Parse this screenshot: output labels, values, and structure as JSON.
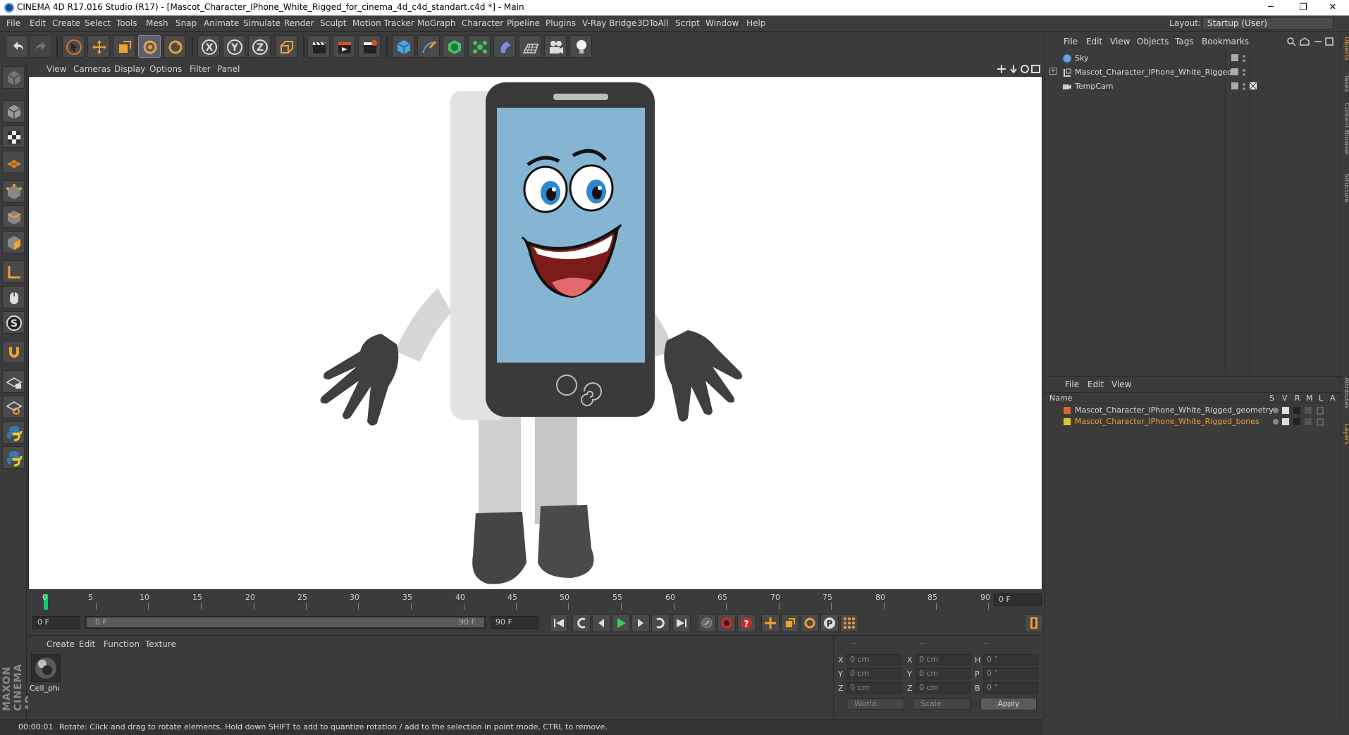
{
  "window": {
    "title": "CINEMA 4D R17.016 Studio (R17) - [Mascot_Character_IPhone_White_Rigged_for_cinema_4d_c4d_standart.c4d *] - Main",
    "minimize": "─",
    "restore": "❐",
    "close": "✕"
  },
  "menu": [
    "File",
    "Edit",
    "Create",
    "Select",
    "Tools",
    "Mesh",
    "Snap",
    "Animate",
    "Simulate",
    "Render",
    "Sculpt",
    "Motion Tracker",
    "MoGraph",
    "Character",
    "Pipeline",
    "Plugins",
    "V-Ray Bridge",
    "3DToAll",
    "Script",
    "Window",
    "Help"
  ],
  "layout": {
    "label": "Layout:",
    "value": "Startup (User)"
  },
  "viewport_menu": [
    "View",
    "Cameras",
    "Display",
    "Options",
    "Filter",
    "Panel"
  ],
  "timeline": {
    "ticks": [
      "0",
      "5",
      "10",
      "15",
      "20",
      "25",
      "30",
      "35",
      "40",
      "45",
      "50",
      "55",
      "60",
      "65",
      "70",
      "75",
      "80",
      "85",
      "90"
    ],
    "current_frame": "0 F",
    "start_field": "0 F",
    "range_start": "0 F",
    "range_end": "90 F",
    "end_field": "90 F"
  },
  "material_manager": {
    "menu": [
      "Create",
      "Edit",
      "Function",
      "Texture"
    ],
    "materials": [
      {
        "name": "Cell_pho"
      }
    ]
  },
  "coordinates": {
    "header": [
      "--",
      "--",
      "--"
    ],
    "rows": [
      {
        "l1": "X",
        "v1": "0 cm",
        "l2": "X",
        "v2": "0 cm",
        "l3": "H",
        "v3": "0 °"
      },
      {
        "l1": "Y",
        "v1": "0 cm",
        "l2": "Y",
        "v2": "0 cm",
        "l3": "P",
        "v3": "0 °"
      },
      {
        "l1": "Z",
        "v1": "0 cm",
        "l2": "Z",
        "v2": "0 cm",
        "l3": "B",
        "v3": "0 °"
      }
    ],
    "space": "World",
    "mode": "Scale",
    "apply": "Apply"
  },
  "status": {
    "time": "00:00:01",
    "text": "Rotate: Click and drag to rotate elements. Hold down SHIFT to add to quantize rotation / add to the selection in point mode, CTRL to remove."
  },
  "object_manager": {
    "menu": [
      "File",
      "Edit",
      "View",
      "Objects",
      "Tags",
      "Bookmarks"
    ],
    "objects": [
      {
        "name": "Sky"
      },
      {
        "name": "Mascot_Character_IPhone_White_Rigged"
      },
      {
        "name": "TempCam"
      }
    ]
  },
  "layer_manager": {
    "menu": [
      "File",
      "Edit",
      "View"
    ],
    "name_header": "Name",
    "columns": [
      "S",
      "V",
      "R",
      "M",
      "L",
      "A"
    ],
    "layers": [
      {
        "name": "Mascot_Character_IPhone_White_Rigged_geometry",
        "color": "#d9662b"
      },
      {
        "name": "Mascot_Character_IPhone_White_Rigged_bones",
        "color": "#e3c52a"
      }
    ]
  },
  "right_tabs": [
    "Objects",
    "Takes",
    "Content Browser",
    "Structure",
    "Attributes",
    "Layers"
  ],
  "colors": {
    "accent": "#f0a030",
    "playhead": "#00d46a",
    "screen": "#85b5d2"
  }
}
